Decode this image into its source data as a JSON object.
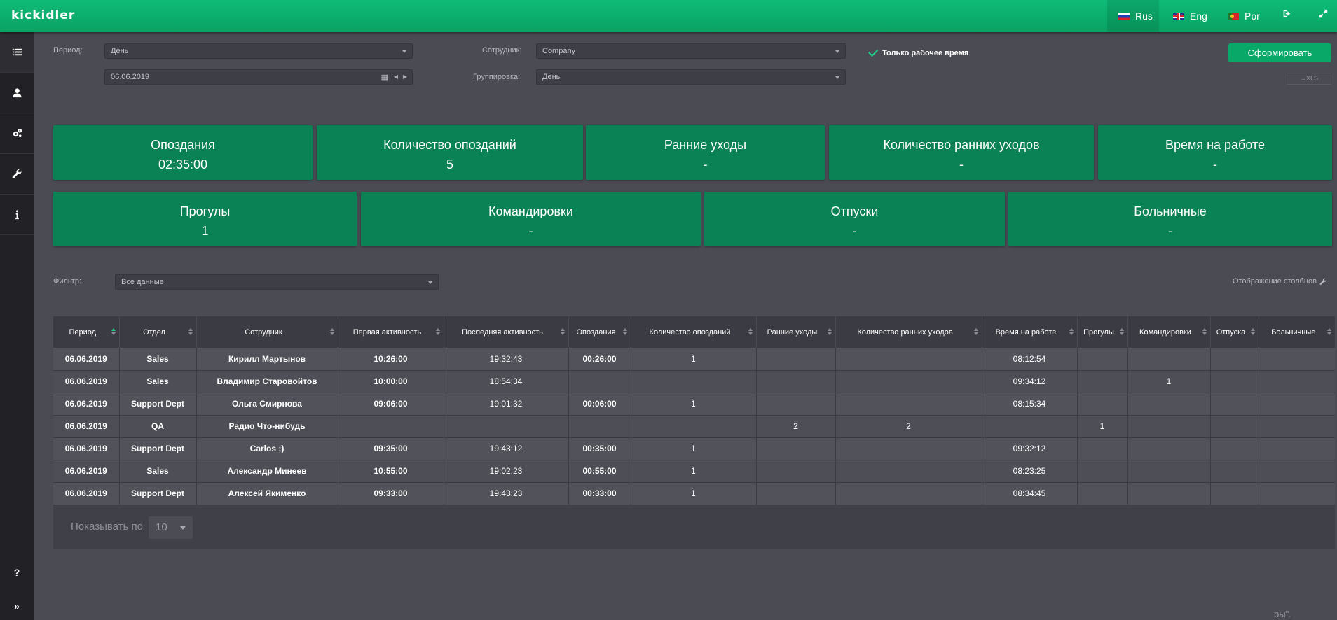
{
  "header": {
    "logo": "kickidler",
    "languages": [
      {
        "code": "ru",
        "label": "Rus",
        "active": true
      },
      {
        "code": "en",
        "label": "Eng",
        "active": false
      },
      {
        "code": "pt",
        "label": "Por",
        "active": false
      }
    ],
    "brand_color": "#0aa868"
  },
  "sidebar": {
    "items": [
      {
        "icon": "list-icon",
        "active": true
      },
      {
        "icon": "user-icon",
        "active": false
      },
      {
        "icon": "gears-icon",
        "active": false
      },
      {
        "icon": "wrench-icon",
        "active": false
      },
      {
        "icon": "info-icon",
        "active": false
      }
    ],
    "bottom": [
      {
        "icon": "help-icon",
        "label": "?"
      },
      {
        "icon": "expand-icon",
        "label": "»"
      }
    ]
  },
  "filters": {
    "period_label": "Период:",
    "period_value": "День",
    "date_value": "06.06.2019",
    "employee_label": "Сотрудник:",
    "employee_value": "Company",
    "grouping_label": "Группировка:",
    "grouping_value": "День",
    "working_time_only": "Только рабочее время",
    "generate_button": "Сформировать",
    "xls_button": "→XLS"
  },
  "cards_row1": [
    {
      "title": "Опоздания",
      "value": "02:35:00"
    },
    {
      "title": "Количество опозданий",
      "value": "5"
    },
    {
      "title": "Ранние уходы",
      "value": "-"
    },
    {
      "title": "Количество ранних уходов",
      "value": "-"
    },
    {
      "title": "Время на работе",
      "value": "-"
    }
  ],
  "cards_row2": [
    {
      "title": "Прогулы",
      "value": "1"
    },
    {
      "title": "Командировки",
      "value": "-"
    },
    {
      "title": "Отпуски",
      "value": "-"
    },
    {
      "title": "Больничные",
      "value": "-"
    }
  ],
  "table_filter": {
    "label": "Фильтр:",
    "value": "Все данные",
    "columns_display": "Отображение столбцов"
  },
  "table": {
    "columns": [
      "Период",
      "Отдел",
      "Сотрудник",
      "Первая активность",
      "Последняя активность",
      "Опоздания",
      "Количество опозданий",
      "Ранние уходы",
      "Количество ранних уходов",
      "Время на работе",
      "Прогулы",
      "Командировки",
      "Отпуска",
      "Больничные"
    ],
    "rows": [
      [
        "06.06.2019",
        "Sales",
        "Кирилл Мартынов",
        "10:26:00",
        "19:32:43",
        "00:26:00",
        "1",
        "",
        "",
        "08:12:54",
        "",
        "",
        "",
        ""
      ],
      [
        "06.06.2019",
        "Sales",
        "Владимир Старовойтов",
        "10:00:00",
        "18:54:34",
        "",
        "",
        "",
        "",
        "09:34:12",
        "",
        "1",
        "",
        ""
      ],
      [
        "06.06.2019",
        "Support Dept",
        "Ольга Смирнова",
        "09:06:00",
        "19:01:32",
        "00:06:00",
        "1",
        "",
        "",
        "08:15:34",
        "",
        "",
        "",
        ""
      ],
      [
        "06.06.2019",
        "QA",
        "Радио Что-нибудь",
        "",
        "",
        "",
        "",
        "2",
        "2",
        "",
        "1",
        "",
        "",
        ""
      ],
      [
        "06.06.2019",
        "Support Dept",
        "Carlos ;)",
        "09:35:00",
        "19:43:12",
        "00:35:00",
        "1",
        "",
        "",
        "09:32:12",
        "",
        "",
        "",
        ""
      ],
      [
        "06.06.2019",
        "Sales",
        "Александр Минеев",
        "10:55:00",
        "19:02:23",
        "00:55:00",
        "1",
        "",
        "",
        "08:23:25",
        "",
        "",
        "",
        ""
      ],
      [
        "06.06.2019",
        "Support Dept",
        "Алексей Якименко",
        "09:33:00",
        "19:43:23",
        "00:33:00",
        "1",
        "",
        "",
        "08:34:45",
        "",
        "",
        "",
        ""
      ]
    ]
  },
  "pager": {
    "label": "Показывать по",
    "value": "10"
  },
  "stray_text": "ры\"."
}
